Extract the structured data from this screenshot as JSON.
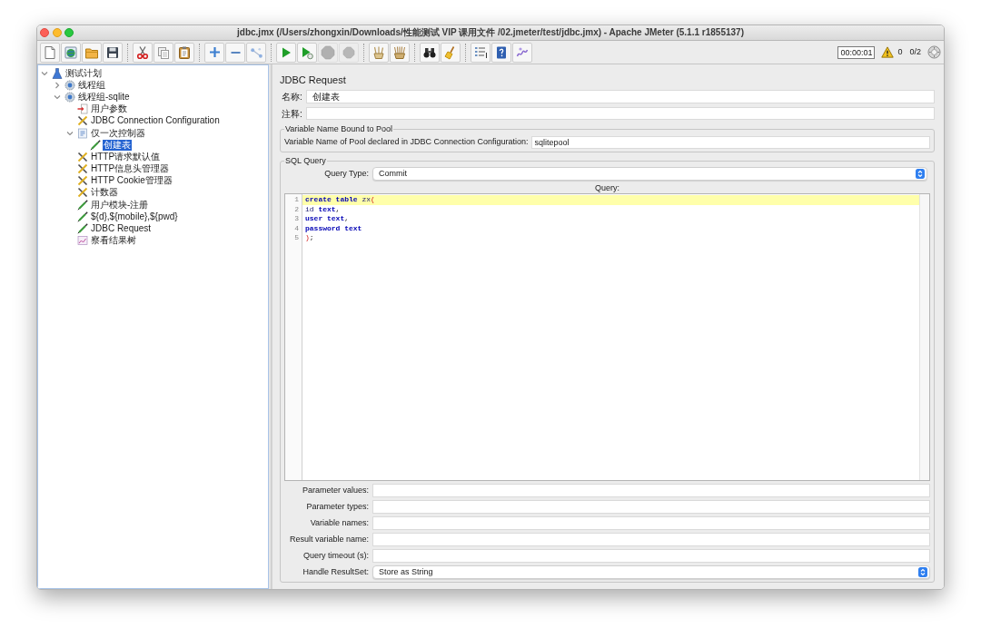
{
  "window": {
    "title": "jdbc.jmx (/Users/zhongxin/Downloads/性能测试 VIP 课用文件 /02.jmeter/test/jdbc.jmx) - Apache JMeter (5.1.1 r1855137)"
  },
  "toolbar": {
    "groups": [
      [
        {
          "kind": "new",
          "disabled": false
        },
        {
          "kind": "templates",
          "disabled": false
        },
        {
          "kind": "open",
          "disabled": false
        },
        {
          "kind": "save",
          "disabled": false
        }
      ],
      [
        {
          "kind": "cut",
          "disabled": false
        },
        {
          "kind": "copy",
          "disabled": false
        },
        {
          "kind": "paste",
          "disabled": false
        }
      ],
      [
        {
          "kind": "expand",
          "disabled": false
        },
        {
          "kind": "collapse",
          "disabled": false
        },
        {
          "kind": "toggle",
          "disabled": false
        }
      ],
      [
        {
          "kind": "start",
          "disabled": false
        },
        {
          "kind": "start_no_pauses",
          "disabled": false
        },
        {
          "kind": "stop",
          "disabled": true
        },
        {
          "kind": "shutdown",
          "disabled": true
        }
      ],
      [
        {
          "kind": "clear",
          "disabled": false
        },
        {
          "kind": "clear_all",
          "disabled": false
        }
      ],
      [
        {
          "kind": "search",
          "disabled": false
        },
        {
          "kind": "reset_search",
          "disabled": false
        }
      ],
      [
        {
          "kind": "function_helper",
          "disabled": false
        },
        {
          "kind": "help",
          "disabled": false
        },
        {
          "kind": "log_viewer",
          "disabled": false
        }
      ]
    ],
    "timer": "00:00:01",
    "error_count": "0",
    "thread_count": "0/2"
  },
  "tree": {
    "items": [
      {
        "label": "测试计划",
        "kind": "test_plan",
        "expanded": true,
        "selected": false,
        "children": [
          {
            "label": "线程组",
            "kind": "thread_group",
            "expanded": false,
            "selected": false
          },
          {
            "label": "线程组-sqlite",
            "kind": "thread_group",
            "expanded": true,
            "selected": false,
            "children": [
              {
                "label": "用户参数",
                "kind": "preprocessor",
                "selected": false
              },
              {
                "label": "JDBC Connection Configuration",
                "kind": "config",
                "selected": false
              },
              {
                "label": "仅一次控制器",
                "kind": "controller",
                "expanded": true,
                "selected": false,
                "children": [
                  {
                    "label": "创建表",
                    "kind": "sampler",
                    "selected": true
                  }
                ]
              },
              {
                "label": "HTTP请求默认值",
                "kind": "config",
                "selected": false
              },
              {
                "label": "HTTP信息头管理器",
                "kind": "config",
                "selected": false
              },
              {
                "label": "HTTP Cookie管理器",
                "kind": "config",
                "selected": false
              },
              {
                "label": "计数器",
                "kind": "config",
                "selected": false
              },
              {
                "label": "用户模块-注册",
                "kind": "sampler",
                "selected": false
              },
              {
                "label": "${d},${mobile},${pwd}",
                "kind": "sampler",
                "selected": false
              },
              {
                "label": "JDBC Request",
                "kind": "sampler",
                "selected": false
              },
              {
                "label": "察看结果树",
                "kind": "listener",
                "selected": false
              }
            ]
          }
        ]
      }
    ]
  },
  "editor": {
    "title": "JDBC Request",
    "name": {
      "label": "名称:",
      "value": "创建表"
    },
    "comments": {
      "label": "注释:"
    },
    "pool": {
      "legend": "Variable Name Bound to Pool",
      "label": "Variable Name of Pool declared in JDBC Connection Configuration:",
      "value": "sqlitepool"
    },
    "sql": {
      "legend": "SQL Query",
      "query_type": {
        "kind": "select",
        "label": "Query Type:",
        "value": "Commit"
      },
      "query_label": "Query:",
      "code_lines": [
        {
          "number": "1",
          "current": true,
          "tokens": [
            {
              "kind": "keyword",
              "text": "create table "
            },
            {
              "kind": "identifier",
              "text": "zx"
            },
            {
              "kind": "operator",
              "text": "("
            }
          ]
        },
        {
          "number": "2",
          "current": false,
          "tokens": [
            {
              "kind": "identifier",
              "text": "id "
            },
            {
              "kind": "keyword",
              "text": "text"
            },
            {
              "kind": "separator",
              "text": ","
            }
          ]
        },
        {
          "number": "3",
          "current": false,
          "tokens": [
            {
              "kind": "keyword",
              "text": "user text"
            },
            {
              "kind": "separator",
              "text": ","
            }
          ]
        },
        {
          "number": "4",
          "current": false,
          "tokens": [
            {
              "kind": "keyword",
              "text": "password text"
            }
          ]
        },
        {
          "number": "5",
          "current": false,
          "tokens": [
            {
              "kind": "operator",
              "text": ")"
            },
            {
              "kind": "separator",
              "text": ";"
            }
          ]
        }
      ],
      "fields": [
        {
          "kind": "text",
          "label": "Parameter values:"
        },
        {
          "kind": "text",
          "label": "Parameter types:"
        },
        {
          "kind": "text",
          "label": "Variable names:"
        },
        {
          "kind": "text",
          "label": "Result variable name:"
        },
        {
          "kind": "text",
          "label": "Query timeout (s):"
        },
        {
          "kind": "select",
          "label": "Handle ResultSet:",
          "value": "Store as String"
        }
      ]
    }
  }
}
